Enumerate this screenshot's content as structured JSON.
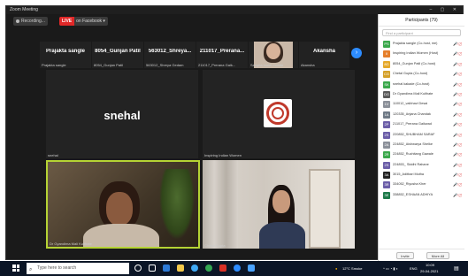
{
  "window": {
    "title": "Zoom Meeting",
    "controls": "–  ▢  ✕"
  },
  "topbar": {
    "recording": "Recording...",
    "live_badge": "LIVE",
    "live_target": "on Facebook ▾"
  },
  "strip": [
    {
      "name": "Prajakta sangle",
      "label": "Prajakta sangle"
    },
    {
      "name": "8054_Gunjan Patil",
      "label": "8054_Gunjan Patil"
    },
    {
      "name": "563012_Shreya...",
      "label": "563012_Shreya Gedam"
    },
    {
      "name": "211017_Prerana...",
      "label": "211017_Prerana Gaik..."
    },
    {
      "name": "",
      "label": "Sangita mukti mohite"
    },
    {
      "name": "Akansha",
      "label": "Akansha"
    }
  ],
  "tiles": {
    "t1": {
      "name": "snehal",
      "label": "snehal"
    },
    "t2": {
      "label": "Inspiring Indian Women"
    },
    "t3": {
      "label": "Dr Gyandima Mali Kulthate"
    },
    "t4": {
      "label": "Chetal Gupta"
    }
  },
  "participants": {
    "title": "Participants (79)",
    "search_placeholder": "Find a participant",
    "rows": [
      {
        "name": "Prajakta sangle (Co-host, me)",
        "color": "#3aa84b",
        "initial": "PS"
      },
      {
        "name": "Inspiring Indian Women (Host)",
        "color": "#e57f2b",
        "initial": "II"
      },
      {
        "name": "8054_Gunjan Patil (Co-host)",
        "color": "#e5a92b",
        "initial": "8G"
      },
      {
        "name": "Chetal Gupta (Co-host)",
        "color": "#d4a028",
        "initial": "CG"
      },
      {
        "name": "snehal kakade (Co-host)",
        "color": "#3aa84b",
        "initial": "SK"
      },
      {
        "name": "Dr Gyandima Mali Kulthate",
        "color": "#5b5b5b",
        "initial": "DG"
      },
      {
        "name": "110012_vaibhavi Desai",
        "color": "#8b9099",
        "initial": "1V"
      },
      {
        "name": "120335_Anjana Chandak",
        "color": "#6f7a86",
        "initial": "1A"
      },
      {
        "name": "211017_Prerana Gaikwad",
        "color": "#6b5ea8",
        "initial": "2P"
      },
      {
        "name": "220852_SHUBHAM SARAF",
        "color": "#6b5ea8",
        "initial": "2S"
      },
      {
        "name": "224852_Aishwarya Shelke",
        "color": "#8b9099",
        "initial": "2A"
      },
      {
        "name": "224852_Ruchitang Gawale",
        "color": "#3aa84b",
        "initial": "2R"
      },
      {
        "name": "224853_ Siddhi Rahane",
        "color": "#6b5ea8",
        "initial": "2S"
      },
      {
        "name": "3015_Aditbari Mutha",
        "color": "#222222",
        "initial": "3A"
      },
      {
        "name": "334052_Riyusha Kher",
        "color": "#6b5ea8",
        "initial": "3R"
      },
      {
        "name": "338852_ESHAAN ADHIYA",
        "color": "#1e7a4a",
        "initial": "3E"
      }
    ],
    "invite_label": "Invite",
    "more_label": "More All"
  },
  "taskbar": {
    "search_placeholder": "Type here to search",
    "weather": "12°C  Smoke",
    "lang": "ENG",
    "time": "10:09",
    "date": "29-04-2021"
  }
}
